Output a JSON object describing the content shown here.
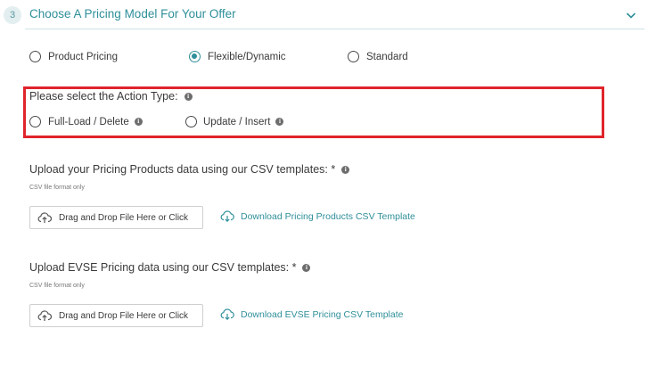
{
  "section": {
    "step_number": "3",
    "title": "Choose A Pricing Model For Your Offer"
  },
  "pricing_model": {
    "options": [
      {
        "label": "Product Pricing",
        "checked": false
      },
      {
        "label": "Flexible/Dynamic",
        "checked": true
      },
      {
        "label": "Standard",
        "checked": false
      }
    ]
  },
  "action_type": {
    "label": "Please select the Action Type:",
    "options": [
      {
        "label": "Full-Load / Delete",
        "checked": false
      },
      {
        "label": "Update / Insert",
        "checked": false
      }
    ],
    "highlight_color": "#e0242c"
  },
  "products_upload": {
    "label": "Upload your Pricing Products data using our CSV templates: *",
    "hint": "CSV file format only",
    "button": "Drag and Drop File Here or Click",
    "template_link": "Download Pricing Products CSV Template"
  },
  "evse_upload": {
    "label": "Upload EVSE Pricing data using our CSV templates: *",
    "hint": "CSV file format only",
    "button": "Drag and Drop File Here or Click",
    "template_link": "Download EVSE Pricing CSV Template"
  },
  "icons": {
    "collapse": "chevron-down-icon",
    "info": "info-icon",
    "upload": "cloud-upload-icon",
    "download": "cloud-download-icon"
  },
  "colors": {
    "accent": "#2f8f9a",
    "text": "#3a3a3a"
  }
}
